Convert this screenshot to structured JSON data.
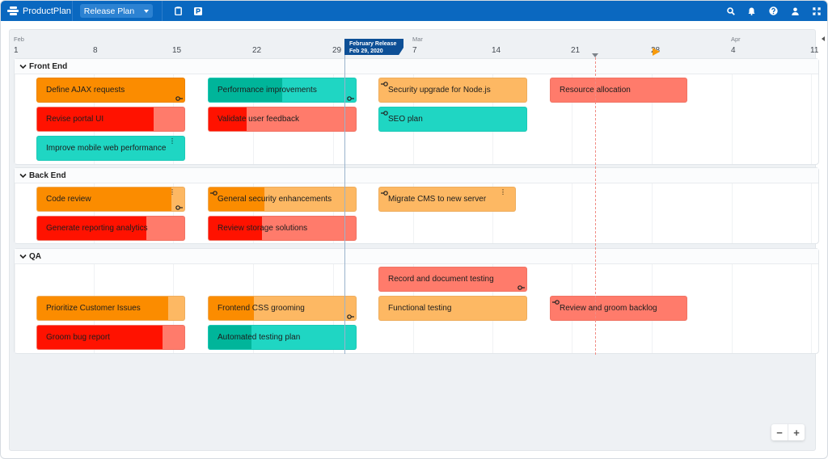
{
  "topbar": {
    "brand": "ProductPlan",
    "plan_selector": "Release Plan",
    "icons": [
      "clipboard-icon",
      "parking-icon",
      "search-icon",
      "bell-icon",
      "help-icon",
      "user-icon",
      "expand-icon"
    ]
  },
  "timeline": {
    "months": [
      {
        "label": "Feb"
      },
      {
        "label": "Mar"
      },
      {
        "label": "Apr"
      }
    ],
    "days": [
      "1",
      "8",
      "15",
      "22",
      "29",
      "7",
      "14",
      "21",
      "28",
      "4",
      "11"
    ],
    "release": {
      "name": "February Release",
      "date": "Feb 29, 2020"
    },
    "milestone_label": "milestone",
    "today_marker": "today"
  },
  "colors": {
    "orange": "#fb8c00",
    "orange_light": "#fdb863",
    "red": "#ff1200",
    "red_light": "#ff7b6b",
    "teal": "#00b59a",
    "teal_light": "#1fd6c3",
    "brand": "#0a68c0",
    "release": "#0d4f96"
  },
  "lanes": [
    {
      "name": "Front End",
      "bars": [
        {
          "label": "Define AJAX requests",
          "color": "orange",
          "progress": 1.0,
          "dep_right": true
        },
        {
          "label": "Revise portal UI",
          "color": "red",
          "progress": 0.79
        },
        {
          "label": "Improve mobile web performance",
          "color": "teal",
          "progress": 0.0,
          "grip": true
        },
        {
          "label": "Performance improvements",
          "color": "teal",
          "progress": 0.5,
          "dep_right": true
        },
        {
          "label": "Validate user feedback",
          "color": "red",
          "progress": 0.26
        },
        {
          "label": "Security upgrade for Node.js",
          "color": "orange",
          "progress": 0.0,
          "dep_left": true
        },
        {
          "label": "SEO plan",
          "color": "teal",
          "progress": 0.0,
          "dep_left": true
        },
        {
          "label": "Resource allocation",
          "color": "red",
          "progress": 0.0
        }
      ]
    },
    {
      "name": "Back End",
      "bars": [
        {
          "label": "Code review",
          "color": "orange",
          "progress": 0.91,
          "dep_right": true,
          "grip": true
        },
        {
          "label": "Generate reporting analytics",
          "color": "red",
          "progress": 0.74
        },
        {
          "label": "General security enhancements",
          "color": "orange",
          "progress": 0.38,
          "dep_left": true
        },
        {
          "label": "Review storage solutions",
          "color": "red",
          "progress": 0.36
        },
        {
          "label": "Migrate CMS to new server",
          "color": "orange",
          "progress": 0.0,
          "dep_left": true,
          "grip": true
        }
      ]
    },
    {
      "name": "QA",
      "bars": [
        {
          "label": "Record and document testing",
          "color": "red",
          "progress": 0.0,
          "dep_right": true
        },
        {
          "label": "Prioritize Customer Issues",
          "color": "orange",
          "progress": 0.89
        },
        {
          "label": "Groom bug report",
          "color": "red",
          "progress": 0.85
        },
        {
          "label": "Frontend CSS grooming",
          "color": "orange",
          "progress": 0.31,
          "dep_right": true
        },
        {
          "label": "Automated testing plan",
          "color": "teal",
          "progress": 0.29
        },
        {
          "label": "Functional testing",
          "color": "orange",
          "progress": 0.0
        },
        {
          "label": "Review and groom backlog",
          "color": "red",
          "progress": 0.0,
          "dep_left": true
        }
      ]
    }
  ],
  "zoom_controls": {
    "minus": "−",
    "plus": "+"
  }
}
